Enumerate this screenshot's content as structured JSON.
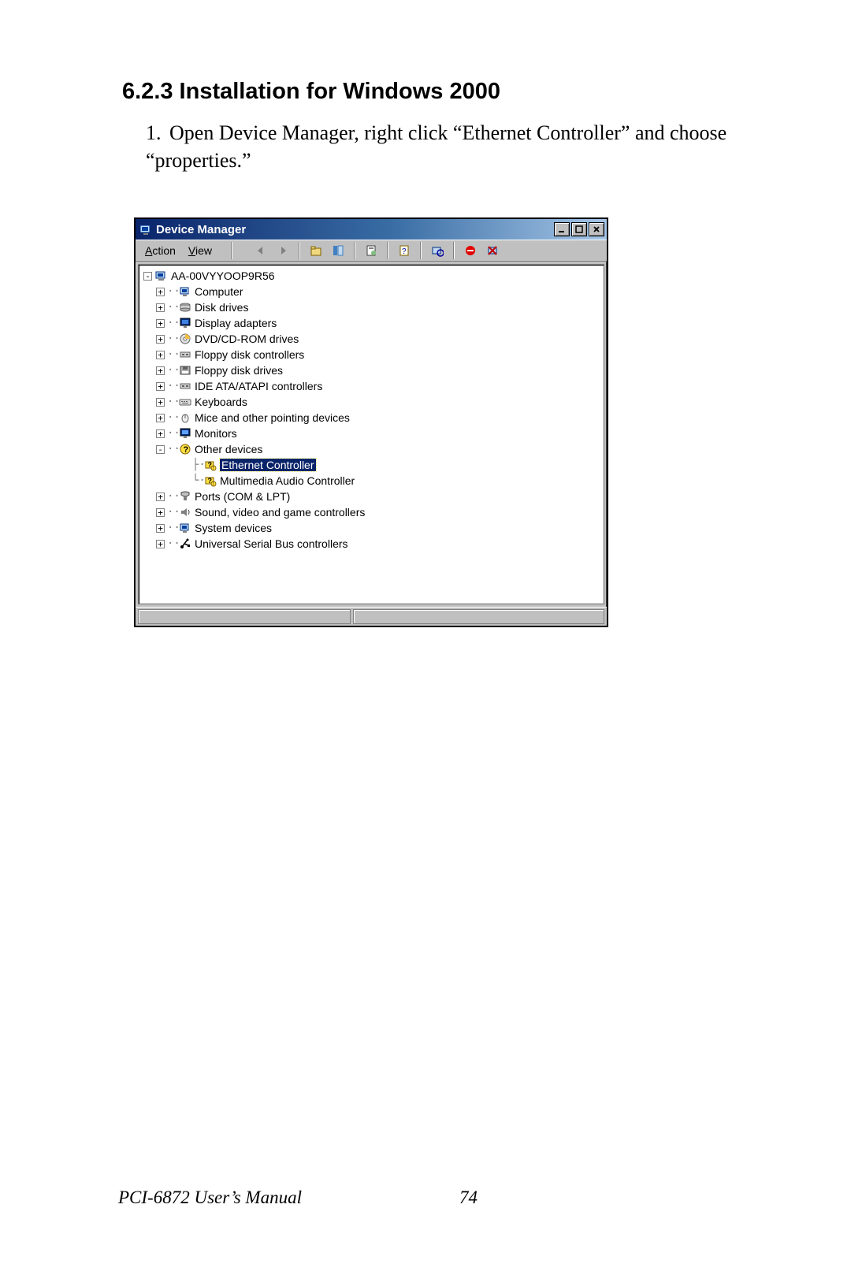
{
  "section": {
    "heading": "6.2.3 Installation for Windows 2000",
    "step_number": "1.",
    "step_text": "Open Device Manager, right click “Ethernet Controller” and choose “properties.”"
  },
  "window": {
    "title": "Device Manager",
    "menu": {
      "action": "Action",
      "view": "View"
    },
    "root": "AA-00VYYOOP9R56",
    "nodes": [
      {
        "label": "Computer",
        "icon": "computer-icon",
        "expand": "+"
      },
      {
        "label": "Disk drives",
        "icon": "disk-icon",
        "expand": "+"
      },
      {
        "label": "Display adapters",
        "icon": "display-icon",
        "expand": "+"
      },
      {
        "label": "DVD/CD-ROM drives",
        "icon": "cdrom-icon",
        "expand": "+"
      },
      {
        "label": "Floppy disk controllers",
        "icon": "controller-icon",
        "expand": "+"
      },
      {
        "label": "Floppy disk drives",
        "icon": "floppy-icon",
        "expand": "+"
      },
      {
        "label": "IDE ATA/ATAPI controllers",
        "icon": "controller-icon",
        "expand": "+"
      },
      {
        "label": "Keyboards",
        "icon": "keyboard-icon",
        "expand": "+"
      },
      {
        "label": "Mice and other pointing devices",
        "icon": "mouse-icon",
        "expand": "+"
      },
      {
        "label": "Monitors",
        "icon": "monitor-icon",
        "expand": "+"
      },
      {
        "label": "Other devices",
        "icon": "other-icon",
        "expand": "-",
        "children": [
          {
            "label": "Ethernet Controller",
            "icon": "unknown-icon",
            "selected": true
          },
          {
            "label": "Multimedia Audio Controller",
            "icon": "unknown-icon",
            "selected": false
          }
        ]
      },
      {
        "label": "Ports (COM & LPT)",
        "icon": "ports-icon",
        "expand": "+"
      },
      {
        "label": "Sound, video and game controllers",
        "icon": "sound-icon",
        "expand": "+"
      },
      {
        "label": "System devices",
        "icon": "system-icon",
        "expand": "+"
      },
      {
        "label": "Universal Serial Bus controllers",
        "icon": "usb-icon",
        "expand": "+"
      }
    ]
  },
  "footer": {
    "manual": "PCI-6872 User’s Manual",
    "page": "74"
  }
}
